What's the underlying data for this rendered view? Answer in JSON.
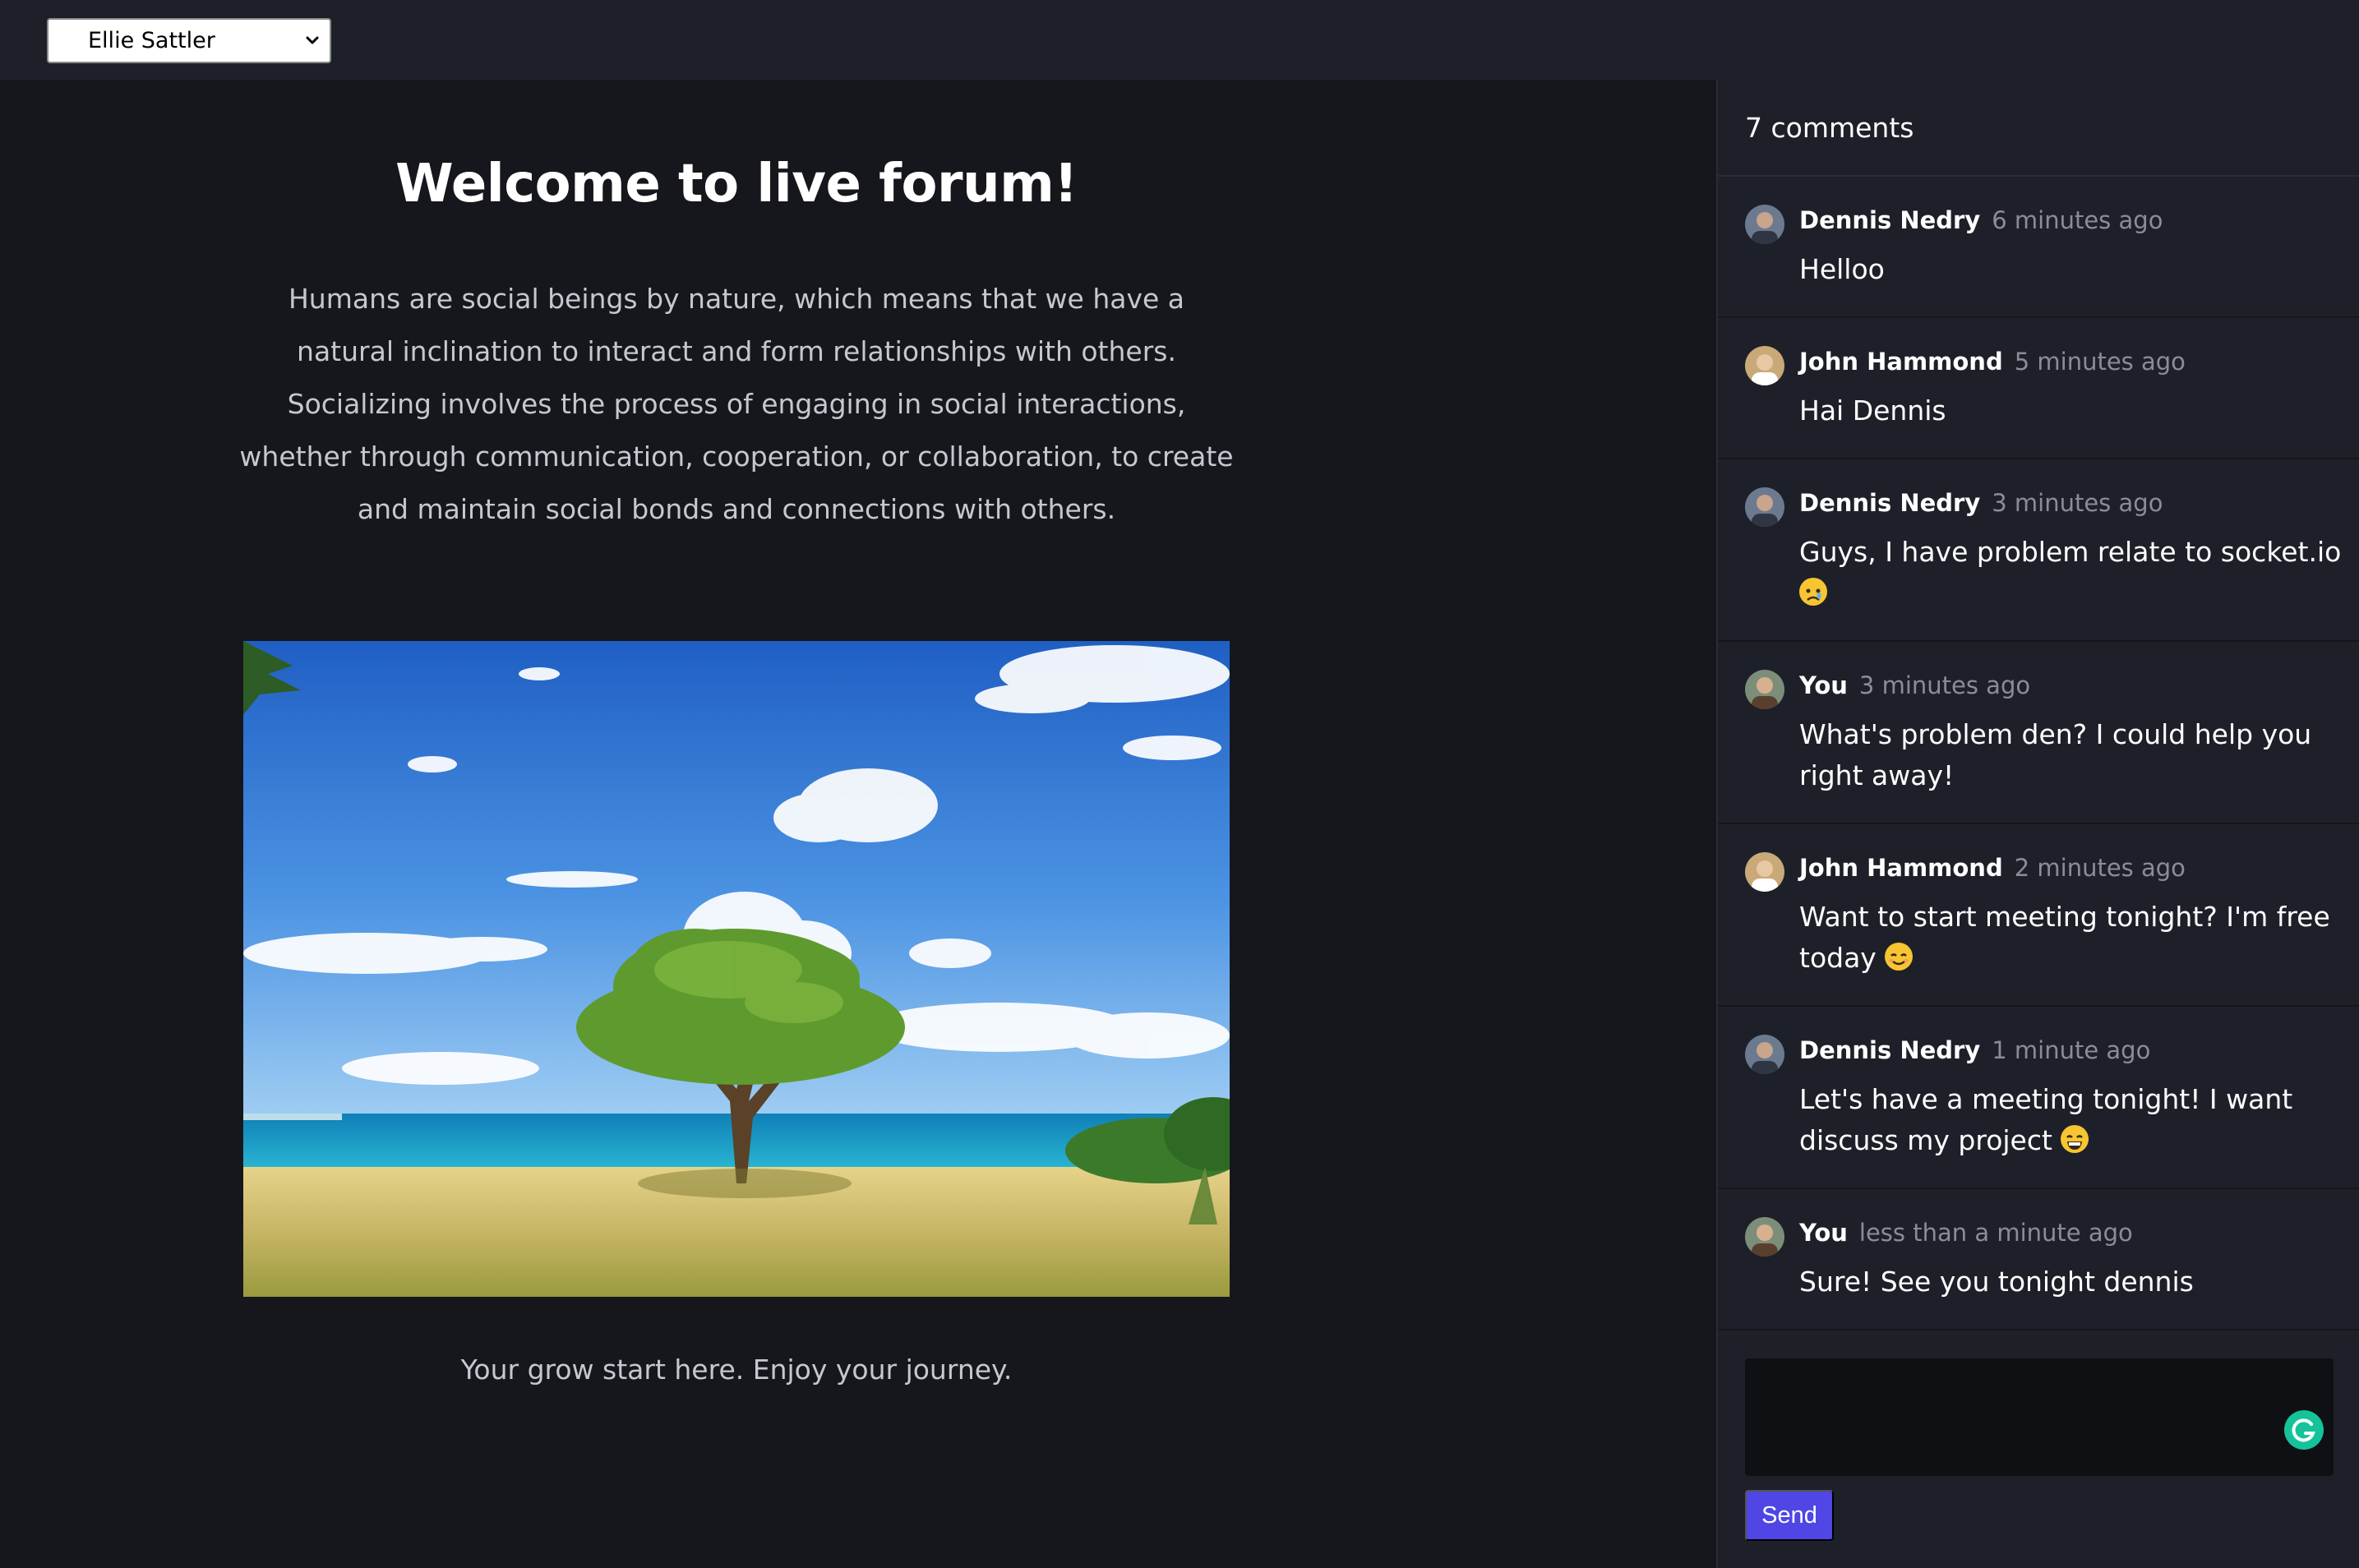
{
  "topbar": {
    "user_select": {
      "value": "Ellie Sattler"
    }
  },
  "main": {
    "title": "Welcome to live forum!",
    "intro": "Humans are social beings by nature, which means that we have a natural inclination to interact and form relationships with others. Socializing involves the process of engaging in social interactions, whether through communication, cooperation, or collaboration, to create and maintain social bonds and connections with others.",
    "tagline": "Your grow start here. Enjoy your journey."
  },
  "comments_panel": {
    "count_label": "7 comments",
    "comments": [
      {
        "author": "Dennis Nedry",
        "time": "6 minutes ago",
        "text": "Helloo",
        "emoji": ""
      },
      {
        "author": "John Hammond",
        "time": "5 minutes ago",
        "text": "Hai Dennis",
        "emoji": ""
      },
      {
        "author": "Dennis Nedry",
        "time": "3 minutes ago",
        "text": "Guys, I have problem relate to socket.io",
        "emoji": "sad-face-emoji"
      },
      {
        "author": "You",
        "time": "3 minutes ago",
        "text": "What's problem den? I could help you right away!",
        "emoji": ""
      },
      {
        "author": "John Hammond",
        "time": "2 minutes ago",
        "text": "Want to start meeting tonight? I'm free today",
        "emoji": "smiling-face-emoji"
      },
      {
        "author": "Dennis Nedry",
        "time": "1 minute ago",
        "text": "Let's have a meeting tonight! I want discuss my project",
        "emoji": "grinning-face-emoji"
      },
      {
        "author": "You",
        "time": "less than a minute ago",
        "text": "Sure! See you tonight dennis",
        "emoji": ""
      }
    ],
    "composer": {
      "value": ""
    },
    "send_label": "Send"
  },
  "colors": {
    "background": "#16171d",
    "panel": "#1e2029",
    "accent": "#4f46e5",
    "muted_text": "#8a8c97"
  }
}
